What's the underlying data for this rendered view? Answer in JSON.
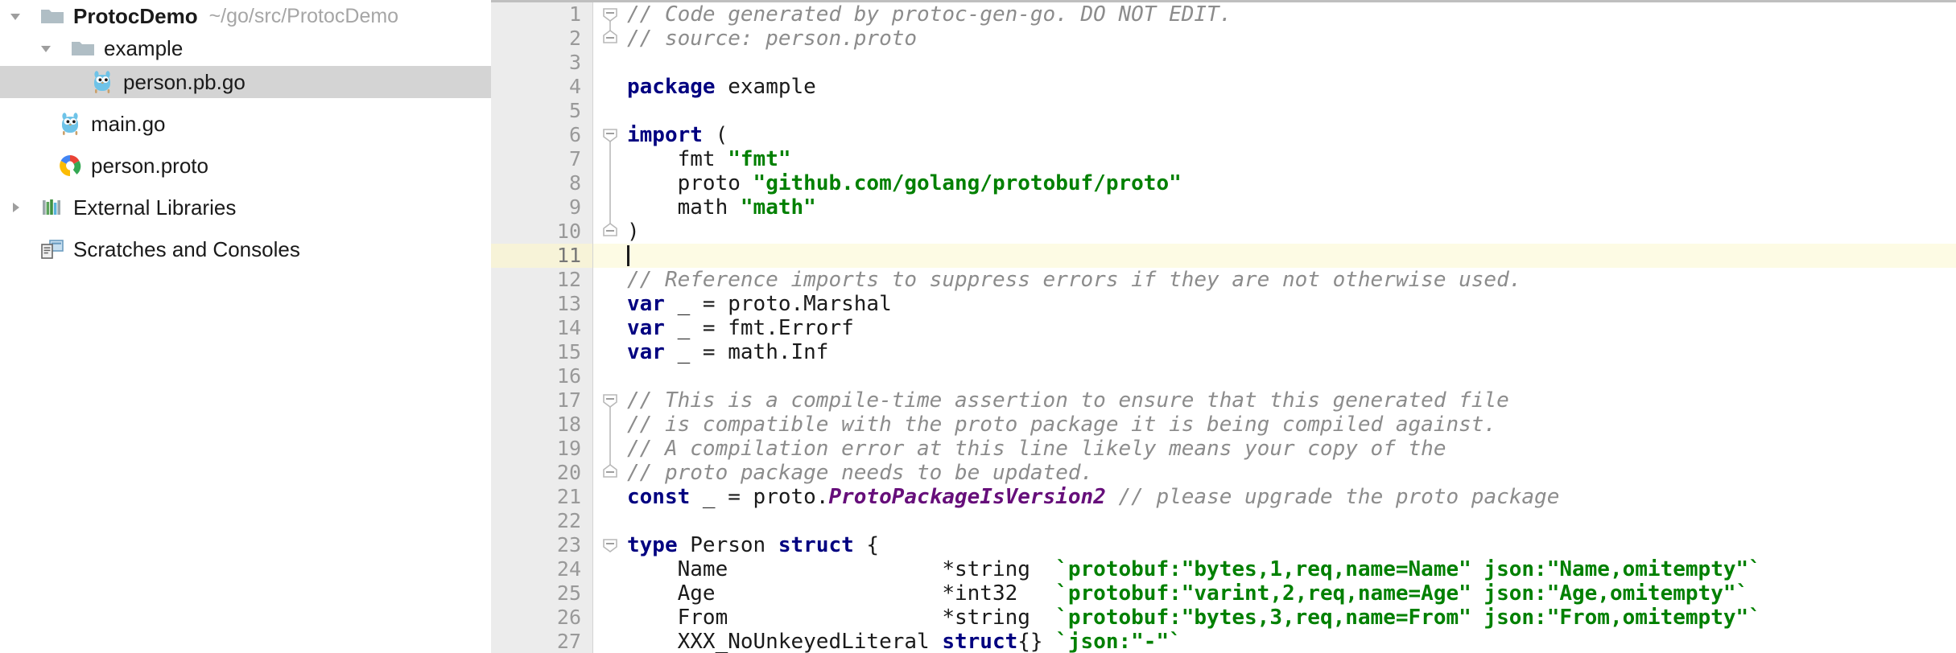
{
  "app": {
    "theme": "light",
    "accent_keyword": "#000080",
    "accent_string": "#008000",
    "accent_comment": "#8c8c8c",
    "accent_constant": "#660e7a",
    "selection_bg": "#d4d4d4",
    "current_line_bg": "#fdfbe4"
  },
  "sidebar": {
    "items": [
      {
        "label": "ProtocDemo",
        "path": "~/go/src/ProtocDemo",
        "icon": "folder-icon",
        "arrow": "chevron-down-icon",
        "depth": 0,
        "selected": false,
        "bold": true
      },
      {
        "label": "example",
        "path": "",
        "icon": "folder-icon",
        "arrow": "chevron-down-icon",
        "depth": 1,
        "selected": false,
        "bold": false
      },
      {
        "label": "person.pb.go",
        "path": "",
        "icon": "go-gopher-icon",
        "arrow": "none",
        "depth": 2,
        "selected": true,
        "bold": false
      },
      {
        "label": "main.go",
        "path": "",
        "icon": "go-gopher-icon",
        "arrow": "none",
        "depth": 1,
        "selected": false,
        "bold": false
      },
      {
        "label": "person.proto",
        "path": "",
        "icon": "protobuf-icon",
        "arrow": "none",
        "depth": 1,
        "selected": false,
        "bold": false
      },
      {
        "label": "External Libraries",
        "path": "",
        "icon": "libraries-icon",
        "arrow": "chevron-right-icon",
        "depth": 0,
        "selected": false,
        "bold": false
      },
      {
        "label": "Scratches and Consoles",
        "path": "",
        "icon": "scratches-icon",
        "arrow": "none",
        "depth": 0,
        "selected": false,
        "bold": false
      }
    ]
  },
  "editor": {
    "current_line": 11,
    "first_visible_line": 1,
    "last_visible_line": 27,
    "line_numbers": [
      1,
      2,
      3,
      4,
      5,
      6,
      7,
      8,
      9,
      10,
      11,
      12,
      13,
      14,
      15,
      16,
      17,
      18,
      19,
      20,
      21,
      22,
      23,
      24,
      25,
      26,
      27
    ],
    "fold_markers": [
      {
        "line": 1,
        "type": "fold-collapse-start-icon"
      },
      {
        "line": 2,
        "type": "fold-collapse-end-icon"
      },
      {
        "line": 6,
        "type": "fold-collapse-start-icon"
      },
      {
        "line": 10,
        "type": "fold-collapse-end-icon"
      },
      {
        "line": 17,
        "type": "fold-collapse-start-icon"
      },
      {
        "line": 20,
        "type": "fold-collapse-end-icon"
      },
      {
        "line": 23,
        "type": "fold-collapse-start-icon"
      }
    ],
    "lines": [
      {
        "n": 1,
        "text": "// Code generated by protoc-gen-go. DO NOT EDIT."
      },
      {
        "n": 2,
        "text": "// source: person.proto"
      },
      {
        "n": 3,
        "text": ""
      },
      {
        "n": 4,
        "text": "package example"
      },
      {
        "n": 5,
        "text": ""
      },
      {
        "n": 6,
        "text": "import ("
      },
      {
        "n": 7,
        "text": "    fmt \"fmt\""
      },
      {
        "n": 8,
        "text": "    proto \"github.com/golang/protobuf/proto\""
      },
      {
        "n": 9,
        "text": "    math \"math\""
      },
      {
        "n": 10,
        "text": ")"
      },
      {
        "n": 11,
        "text": ""
      },
      {
        "n": 12,
        "text": "// Reference imports to suppress errors if they are not otherwise used."
      },
      {
        "n": 13,
        "text": "var _ = proto.Marshal"
      },
      {
        "n": 14,
        "text": "var _ = fmt.Errorf"
      },
      {
        "n": 15,
        "text": "var _ = math.Inf"
      },
      {
        "n": 16,
        "text": ""
      },
      {
        "n": 17,
        "text": "// This is a compile-time assertion to ensure that this generated file"
      },
      {
        "n": 18,
        "text": "// is compatible with the proto package it is being compiled against."
      },
      {
        "n": 19,
        "text": "// A compilation error at this line likely means your copy of the"
      },
      {
        "n": 20,
        "text": "// proto package needs to be updated."
      },
      {
        "n": 21,
        "text": "const _ = proto.ProtoPackageIsVersion2 // please upgrade the proto package"
      },
      {
        "n": 22,
        "text": ""
      },
      {
        "n": 23,
        "text": "type Person struct {"
      },
      {
        "n": 24,
        "text": "    Name                 *string  `protobuf:\"bytes,1,req,name=Name\" json:\"Name,omitempty\"`"
      },
      {
        "n": 25,
        "text": "    Age                  *int32   `protobuf:\"varint,2,req,name=Age\" json:\"Age,omitempty\"`"
      },
      {
        "n": 26,
        "text": "    From                 *string  `protobuf:\"bytes,3,req,name=From\" json:\"From,omitempty\"`"
      },
      {
        "n": 27,
        "text": "    XXX_NoUnkeyedLiteral struct{} `json:\"-\"`"
      }
    ],
    "tokens": {
      "l1": [
        {
          "t": "// Code generated by protoc-gen-go. DO NOT EDIT.",
          "c": "c"
        }
      ],
      "l2": [
        {
          "t": "// source: person.proto",
          "c": "c"
        }
      ],
      "l4": [
        {
          "t": "package",
          "c": "k"
        },
        {
          "t": " example",
          "c": "pl"
        }
      ],
      "l6": [
        {
          "t": "import",
          "c": "k"
        },
        {
          "t": " (",
          "c": "pl"
        }
      ],
      "l7": [
        {
          "t": "    fmt ",
          "c": "pl"
        },
        {
          "t": "\"fmt\"",
          "c": "s"
        }
      ],
      "l8": [
        {
          "t": "    proto ",
          "c": "pl"
        },
        {
          "t": "\"github.com/golang/protobuf/proto\"",
          "c": "s"
        }
      ],
      "l9": [
        {
          "t": "    math ",
          "c": "pl"
        },
        {
          "t": "\"math\"",
          "c": "s"
        }
      ],
      "l10": [
        {
          "t": ")",
          "c": "pl"
        }
      ],
      "l12": [
        {
          "t": "// Reference imports to suppress errors if they are not otherwise used.",
          "c": "c"
        }
      ],
      "l13": [
        {
          "t": "var",
          "c": "k"
        },
        {
          "t": " _ = proto.Marshal",
          "c": "pl"
        }
      ],
      "l14": [
        {
          "t": "var",
          "c": "k"
        },
        {
          "t": " _ = fmt.Errorf",
          "c": "pl"
        }
      ],
      "l15": [
        {
          "t": "var",
          "c": "k"
        },
        {
          "t": " _ = math.Inf",
          "c": "pl"
        }
      ],
      "l17": [
        {
          "t": "// This is a compile-time assertion to ensure that this generated file",
          "c": "c"
        }
      ],
      "l18": [
        {
          "t": "// is compatible with the proto package it is being compiled against.",
          "c": "c"
        }
      ],
      "l19": [
        {
          "t": "// A compilation error at this line likely means your copy of the",
          "c": "c"
        }
      ],
      "l20": [
        {
          "t": "// proto package needs to be updated.",
          "c": "c"
        }
      ],
      "l21": [
        {
          "t": "const",
          "c": "k"
        },
        {
          "t": " _ = proto.",
          "c": "pl"
        },
        {
          "t": "ProtoPackageIsVersion2",
          "c": "pc"
        },
        {
          "t": " ",
          "c": "pl"
        },
        {
          "t": "// please upgrade the proto package",
          "c": "c"
        }
      ],
      "l23": [
        {
          "t": "type",
          "c": "k"
        },
        {
          "t": " Person ",
          "c": "pl"
        },
        {
          "t": "struct",
          "c": "k"
        },
        {
          "t": " {",
          "c": "pl"
        }
      ],
      "l24": [
        {
          "t": "    Name                 *string  ",
          "c": "pl"
        },
        {
          "t": "`protobuf:\"bytes,1,req,name=Name\" json:\"Name,omitempty\"`",
          "c": "s"
        }
      ],
      "l25": [
        {
          "t": "    Age                  *int32   ",
          "c": "pl"
        },
        {
          "t": "`protobuf:\"varint,2,req,name=Age\" json:\"Age,omitempty\"`",
          "c": "s"
        }
      ],
      "l26": [
        {
          "t": "    From                 *string  ",
          "c": "pl"
        },
        {
          "t": "`protobuf:\"bytes,3,req,name=From\" json:\"From,omitempty\"`",
          "c": "s"
        }
      ],
      "l27": [
        {
          "t": "    XXX_NoUnkeyedLiteral ",
          "c": "pl"
        },
        {
          "t": "struct",
          "c": "k"
        },
        {
          "t": "{} ",
          "c": "pl"
        },
        {
          "t": "`json:\"-\"`",
          "c": "s"
        }
      ]
    }
  }
}
